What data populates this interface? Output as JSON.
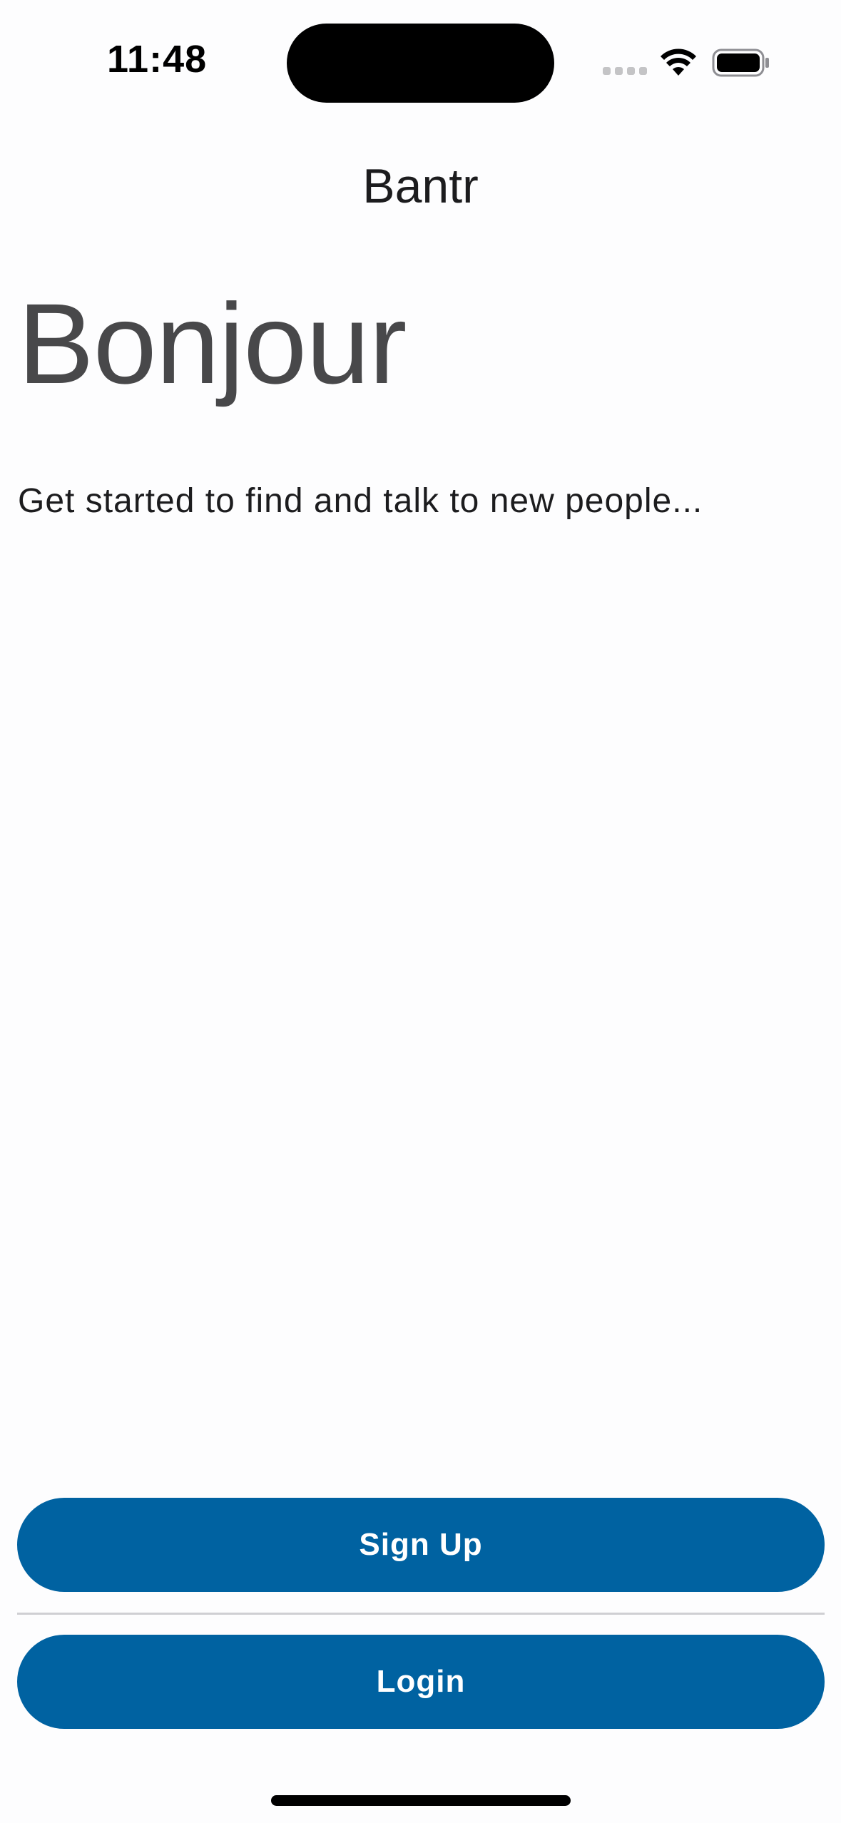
{
  "status_bar": {
    "time": "11:48",
    "icons": [
      "cellular-signal-icon",
      "wifi-icon",
      "battery-icon"
    ]
  },
  "nav": {
    "title": "Bantr"
  },
  "main": {
    "headline": "Bonjour",
    "subtitle": "Get started to find and talk to new people..."
  },
  "actions": {
    "signup_label": "Sign Up",
    "login_label": "Login"
  },
  "colors": {
    "accent": "#0062a1",
    "background": "#fdfdfe",
    "headline_text": "#48484a"
  }
}
